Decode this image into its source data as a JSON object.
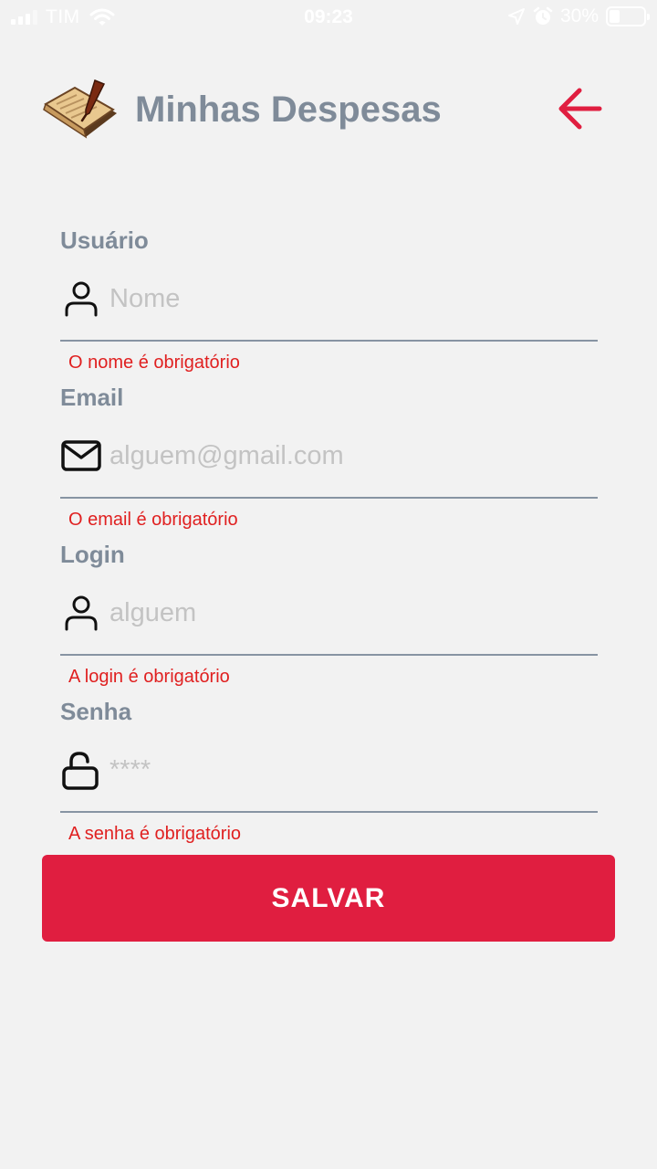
{
  "status_bar": {
    "carrier": "TIM",
    "time": "09:23",
    "battery": "30%",
    "battery_level": 0.3
  },
  "header": {
    "title": "Minhas Despesas",
    "logo_icon": "notebook-quill-icon",
    "back_icon": "arrow-left-icon"
  },
  "form": {
    "fields": [
      {
        "label": "Usuário",
        "placeholder": "Nome",
        "value": "",
        "icon": "user-icon",
        "error": "O nome é obrigatório"
      },
      {
        "label": "Email",
        "placeholder": "alguem@gmail.com",
        "value": "",
        "icon": "envelope-icon",
        "error": "O email é obrigatório"
      },
      {
        "label": "Login",
        "placeholder": "alguem",
        "value": "",
        "icon": "user-icon",
        "error": "A login é obrigatório"
      },
      {
        "label": "Senha",
        "placeholder": "****",
        "value": "",
        "icon": "unlock-icon",
        "error": "A senha é obrigatório"
      }
    ]
  },
  "save_button": {
    "label": "SALVAR"
  },
  "colors": {
    "accent": "#e01e40",
    "error": "#e02020",
    "label": "#7f8b99",
    "background": "#f2f2f2"
  }
}
